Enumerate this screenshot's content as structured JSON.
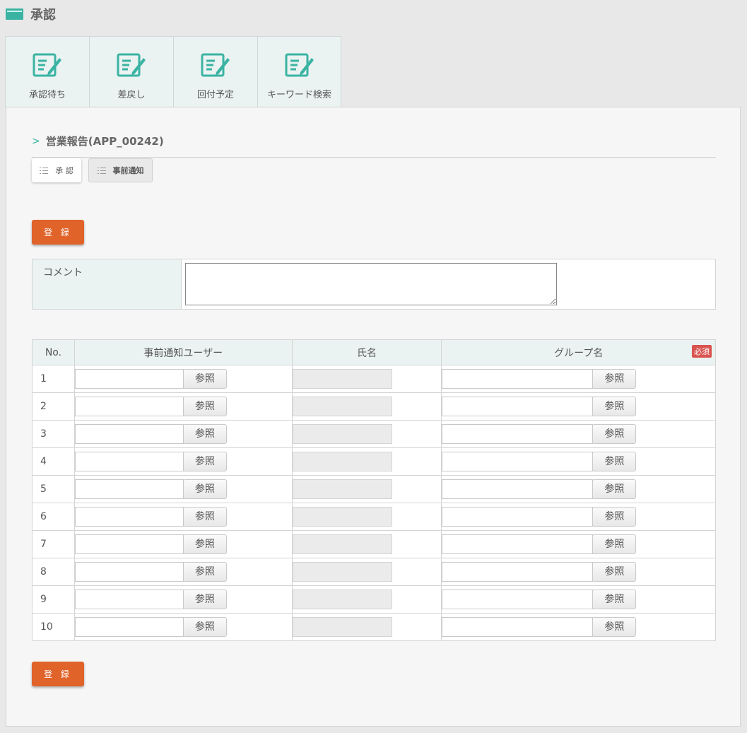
{
  "header": {
    "title": "承認",
    "icon": "window-icon"
  },
  "tabs": [
    {
      "label": "承認待ち",
      "icon": "edit-note-icon"
    },
    {
      "label": "差戻し",
      "icon": "edit-note-icon"
    },
    {
      "label": "回付予定",
      "icon": "edit-note-icon"
    },
    {
      "label": "キーワード検索",
      "icon": "edit-note-icon"
    }
  ],
  "section": {
    "title": "営業報告(APP_00242)"
  },
  "subtabs": {
    "approve": "承 認",
    "notify": "事前通知"
  },
  "register_label": "登 録",
  "comment": {
    "label": "コメント",
    "value": ""
  },
  "table": {
    "headers": {
      "no": "No.",
      "user": "事前通知ユーザー",
      "name": "氏名",
      "group": "グループ名",
      "required": "必須"
    },
    "ref_label": "参照",
    "rows": [
      {
        "no": "1"
      },
      {
        "no": "2"
      },
      {
        "no": "3"
      },
      {
        "no": "4"
      },
      {
        "no": "5"
      },
      {
        "no": "6"
      },
      {
        "no": "7"
      },
      {
        "no": "8"
      },
      {
        "no": "9"
      },
      {
        "no": "10"
      }
    ]
  },
  "colors": {
    "accent": "#3bb3a3",
    "button": "#e0632a",
    "required": "#d9534f",
    "tab_bg": "#eaf3f1"
  }
}
